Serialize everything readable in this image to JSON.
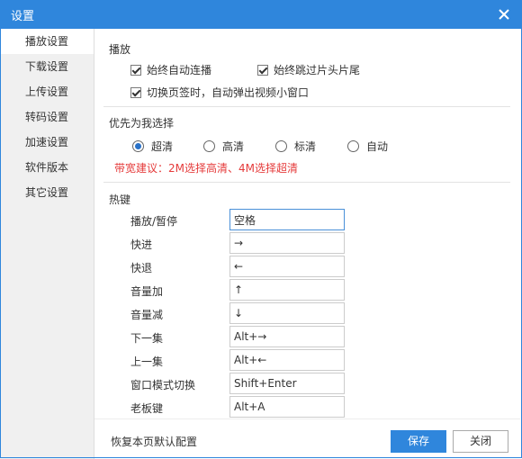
{
  "window": {
    "title": "设置"
  },
  "sidebar": {
    "items": [
      {
        "label": "播放设置"
      },
      {
        "label": "下载设置"
      },
      {
        "label": "上传设置"
      },
      {
        "label": "转码设置"
      },
      {
        "label": "加速设置"
      },
      {
        "label": "软件版本"
      },
      {
        "label": "其它设置"
      }
    ],
    "active_index": 0
  },
  "playback": {
    "title": "播放",
    "options": [
      {
        "label": "始终自动连播",
        "checked": true
      },
      {
        "label": "始终跳过片头片尾",
        "checked": true
      },
      {
        "label": "切换页签时，自动弹出视频小窗口",
        "checked": true
      }
    ]
  },
  "quality": {
    "title": "优先为我选择",
    "options": [
      {
        "label": "超清",
        "selected": true
      },
      {
        "label": "高清",
        "selected": false
      },
      {
        "label": "标清",
        "selected": false
      },
      {
        "label": "自动",
        "selected": false
      }
    ],
    "tip": "带宽建议：2M选择高清、4M选择超清"
  },
  "hotkeys": {
    "title": "热键",
    "items": [
      {
        "label": "播放/暂停",
        "value": "空格"
      },
      {
        "label": "快进",
        "value": "→"
      },
      {
        "label": "快退",
        "value": "←"
      },
      {
        "label": "音量加",
        "value": "↑"
      },
      {
        "label": "音量减",
        "value": "↓"
      },
      {
        "label": "下一集",
        "value": "Alt+→"
      },
      {
        "label": "上一集",
        "value": "Alt+←"
      },
      {
        "label": "窗口模式切换",
        "value": "Shift+Enter"
      },
      {
        "label": "老板键",
        "value": "Alt+A"
      }
    ]
  },
  "footer": {
    "restore": "恢复本页默认配置",
    "save": "保存",
    "close": "关闭"
  },
  "colors": {
    "titlebar": "#2f86dc",
    "tip": "#e53b3b",
    "primary_button": "#2f86dc"
  }
}
